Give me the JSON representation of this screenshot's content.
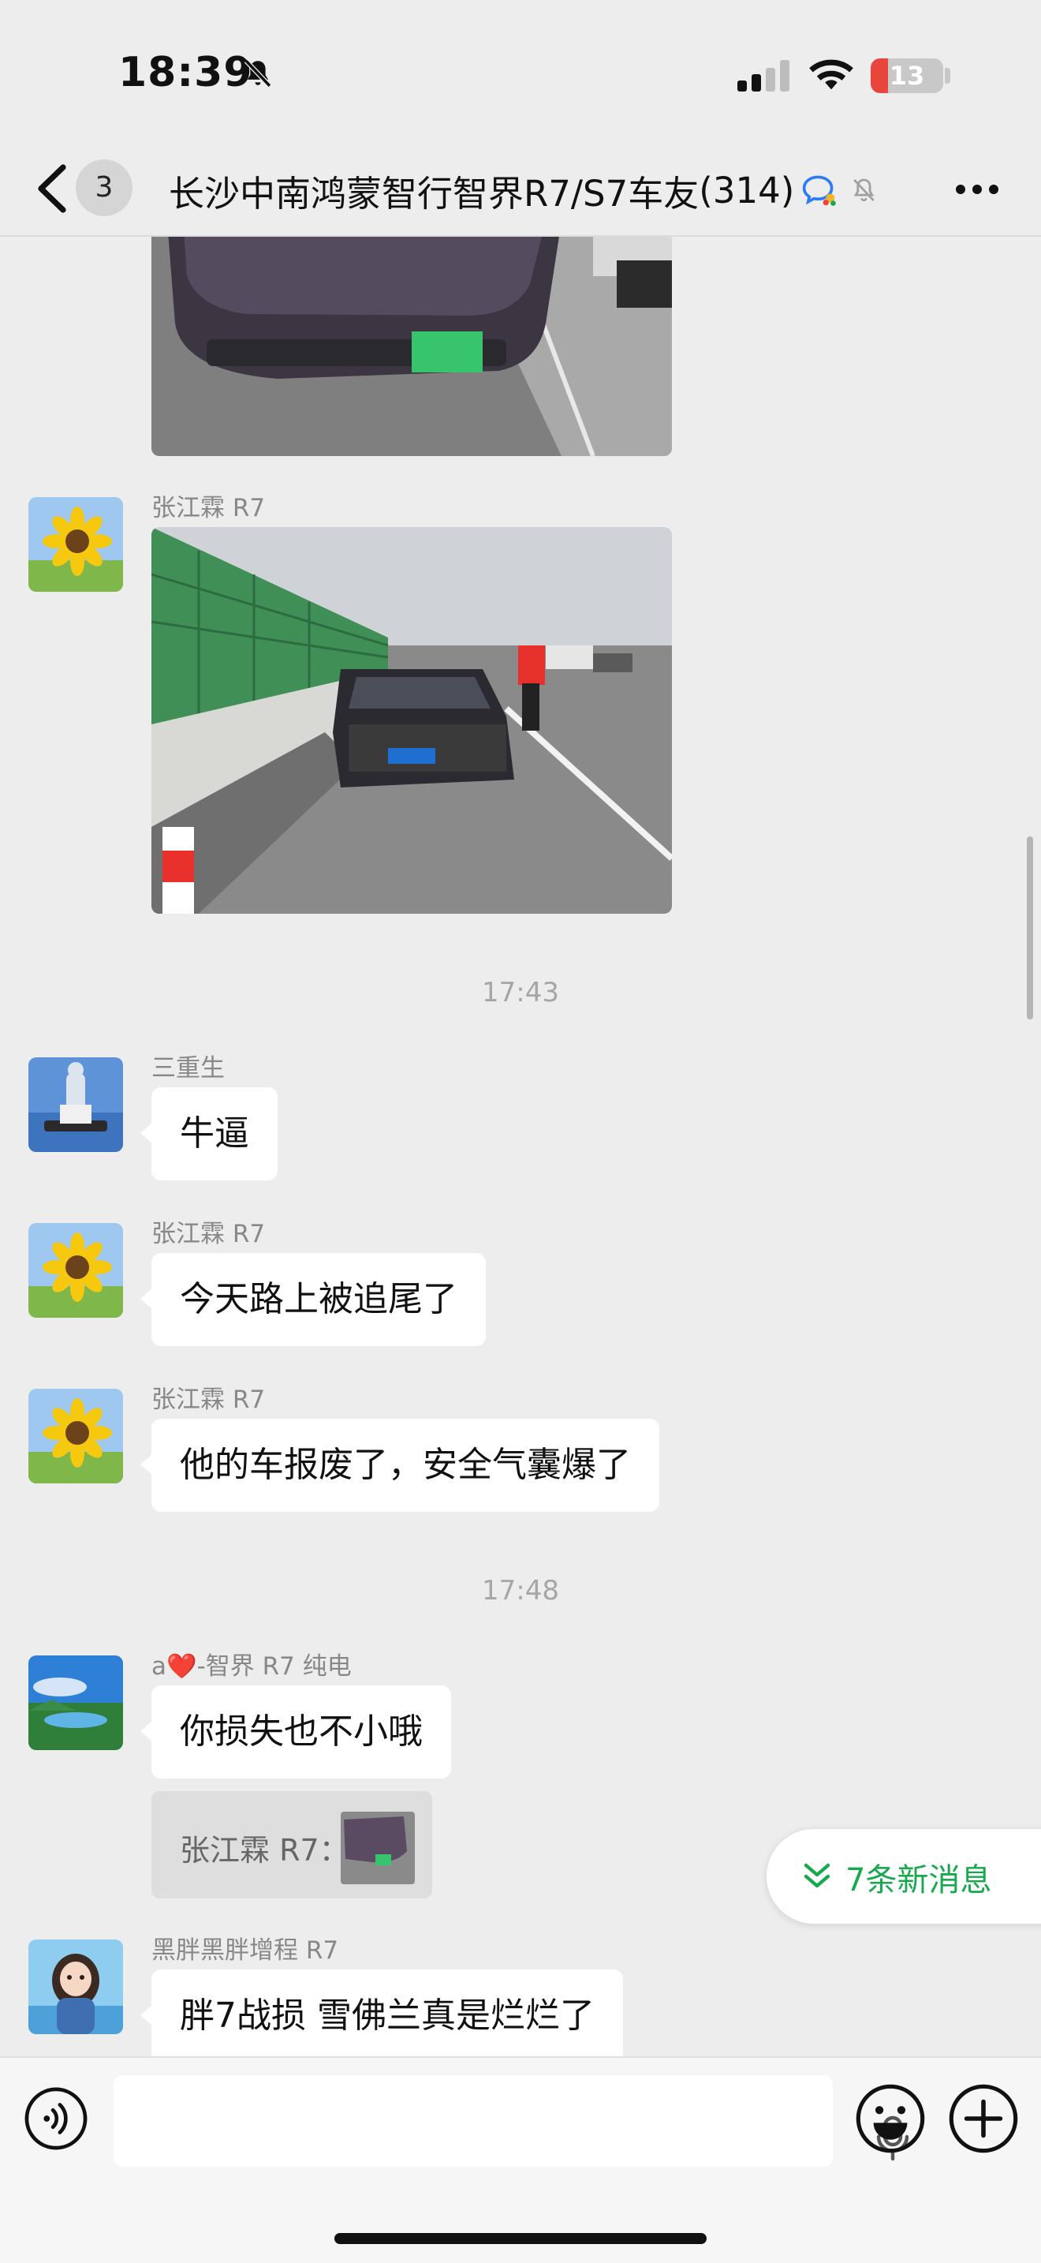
{
  "status_bar": {
    "time": "18:39",
    "battery": "13",
    "battery_level": 0.13,
    "icons": [
      "bell-slash-icon",
      "cellular-signal-icon",
      "wifi-icon",
      "battery-icon"
    ]
  },
  "nav": {
    "unread_count": "3",
    "title": "长沙中南鸿蒙智行智界R7/S7车友",
    "member_count": "(314)",
    "icons": [
      "chevron-left-icon",
      "chat-bubble-icon",
      "bell-slash-icon",
      "more-dots-icon"
    ]
  },
  "messages": [
    {
      "type": "image",
      "description_icon": "photo-car-rear"
    },
    {
      "type": "image",
      "sender": "张江霖 R7",
      "avatar": "sunflower-avatar"
    },
    {
      "type": "time",
      "text": "17:43"
    },
    {
      "type": "text",
      "sender": "三重生",
      "text": "牛逼",
      "avatar": "statue-avatar"
    },
    {
      "type": "text",
      "sender": "张江霖 R7",
      "text": "今天路上被追尾了",
      "avatar": "sunflower-avatar"
    },
    {
      "type": "text",
      "sender": "张江霖 R7",
      "text": "他的车报废了，安全气囊爆了",
      "avatar": "sunflower-avatar"
    },
    {
      "type": "time",
      "text": "17:48"
    },
    {
      "type": "text",
      "sender": "a❤️-智界 R7 纯电",
      "text": "你损失也不小哦",
      "avatar": "lake-avatar",
      "quote": "张江霖 R7："
    },
    {
      "type": "text",
      "sender": "黑胖黑胖增程 R7",
      "text": "胖7战损  雪佛兰真是烂烂了",
      "avatar": "cartoon-girl-avatar"
    }
  ],
  "new_messages_button": {
    "label": "7条新消息",
    "icon": "double-chevron-down-icon"
  },
  "input_bar": {
    "value": "",
    "icons": [
      "voice-icon",
      "microphone-icon",
      "emoji-icon",
      "plus-icon"
    ]
  },
  "colors": {
    "background": "#ededed",
    "bubble": "#ffffff",
    "accent_green": "#18a94f",
    "battery_red": "#e8453c"
  }
}
